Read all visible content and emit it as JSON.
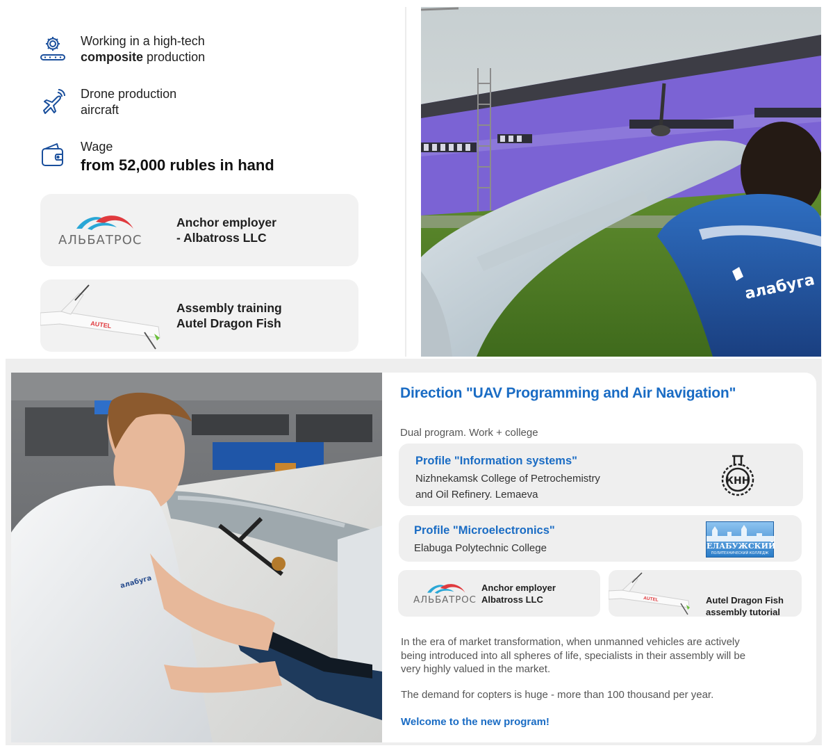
{
  "features": [
    {
      "line1": "Working in a high-tech",
      "line2_bold": "composite",
      "line2_rest": " production",
      "icon": "gear-conveyor-icon"
    },
    {
      "line1": "Drone production",
      "line2": "aircraft",
      "icon": "drone-plane-icon"
    },
    {
      "line1": "Wage",
      "value": "from 52,000 rubles in hand",
      "icon": "wallet-icon"
    }
  ],
  "cards": {
    "anchor": {
      "logo_text": "АЛЬБАТРОС",
      "line1": "Anchor employer",
      "line2": "- Albatross LLC"
    },
    "assembly": {
      "line1": "Assembly training",
      "line2": "Autel Dragon Fish",
      "drone_brand": "AUTEL"
    }
  },
  "photo_top": {
    "jacket_text": "алабуга"
  },
  "photo_bottom": {
    "shirt_text": "алабуга"
  },
  "direction": {
    "title": "Direction \"UAV Programming and Air Navigation\"",
    "subtitle": "Dual program. Work + college",
    "profiles": [
      {
        "title": "Profile \"Information systems\"",
        "line1": "Nizhnekamsk College of Petrochemistry",
        "line2": "and Oil Refinery. Lemaeva",
        "logo_text": "КНН"
      },
      {
        "title": "Profile \"Microelectronics\"",
        "line1": "Elabuga Polytechnic College",
        "logo_text": "ЕЛАБУЖСКИЙ",
        "logo_sub": "ПОЛИТЕХНИЧЕСКИЙ КОЛЛЕДЖ"
      }
    ],
    "mini": {
      "anchor": {
        "logo_text": "АЛЬБАТРОС",
        "line1": "Anchor employer",
        "line2": "Albatross LLC"
      },
      "tutorial": {
        "line1": "Autel Dragon Fish",
        "line2": "assembly tutorial",
        "drone_brand": "AUTEL"
      }
    },
    "paragraph1": {
      "line1": "In the era of market transformation, when unmanned vehicles are actively",
      "line2": "being introduced into all spheres of life, specialists in their assembly will be",
      "line3": "very highly valued in the market."
    },
    "paragraph2": "The demand for copters is huge - more than 100 thousand per year.",
    "welcome": "Welcome to the new program!"
  },
  "colors": {
    "accent_blue": "#1a6cc4",
    "card_bg": "#f2f2f2",
    "icon_blue": "#1a4f9c",
    "logo_red": "#e03a3e",
    "logo_cyan": "#2aa7d6"
  }
}
